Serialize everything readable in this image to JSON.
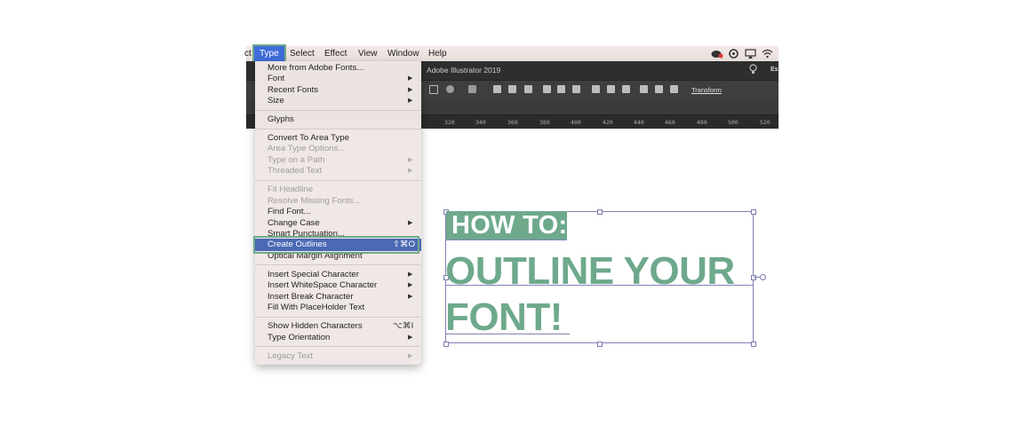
{
  "menubar": {
    "items": [
      {
        "label": "ct"
      },
      {
        "label": "Type"
      },
      {
        "label": "Select"
      },
      {
        "label": "Effect"
      },
      {
        "label": "View"
      },
      {
        "label": "Window"
      },
      {
        "label": "Help"
      }
    ],
    "tray_icons": [
      "creative-cloud-icon",
      "sync-icon",
      "airplay-icon",
      "wifi-icon"
    ]
  },
  "app": {
    "title": "Adobe Illustrator 2019",
    "right_label": "Es",
    "transform_label": "Transform",
    "ruler_ticks": [
      "320",
      "340",
      "360",
      "380",
      "400",
      "420",
      "440",
      "460",
      "480",
      "500",
      "520"
    ]
  },
  "type_menu": {
    "items": [
      {
        "label": "More from Adobe Fonts...",
        "disabled": false
      },
      {
        "label": "Font",
        "submenu": true
      },
      {
        "label": "Recent Fonts",
        "submenu": true
      },
      {
        "label": "Size",
        "submenu": true
      },
      {
        "label": "Glyphs"
      },
      {
        "label": "Convert To Area Type"
      },
      {
        "label": "Area Type Options...",
        "disabled": true
      },
      {
        "label": "Type on a Path",
        "disabled": true,
        "submenu": true
      },
      {
        "label": "Threaded Text",
        "disabled": true,
        "submenu": true
      },
      {
        "label": "Fit Headline",
        "disabled": true
      },
      {
        "label": "Resolve Missing Fonts...",
        "disabled": true
      },
      {
        "label": "Find Font..."
      },
      {
        "label": "Change Case",
        "submenu": true
      },
      {
        "label": "Smart Punctuation..."
      },
      {
        "label": "Create Outlines",
        "shortcut": "⇧⌘O",
        "selected": true
      },
      {
        "label": "Optical Margin Alignment"
      },
      {
        "label": "Insert Special Character",
        "submenu": true
      },
      {
        "label": "Insert WhiteSpace Character",
        "submenu": true
      },
      {
        "label": "Insert Break Character",
        "submenu": true
      },
      {
        "label": "Fill With PlaceHolder Text"
      },
      {
        "label": "Show Hidden Characters",
        "shortcut": "⌥⌘I"
      },
      {
        "label": "Type Orientation",
        "submenu": true
      },
      {
        "label": "Legacy Text",
        "disabled": true,
        "submenu": true
      }
    ]
  },
  "artwork": {
    "line1": "HOW TO:",
    "line2": "OUTLINE YOUR",
    "line3": "FONT!"
  },
  "colors": {
    "accent_green": "#6ea98c",
    "menu_selection": "#4a69b4",
    "menubar_active": "#3f6cd9"
  }
}
